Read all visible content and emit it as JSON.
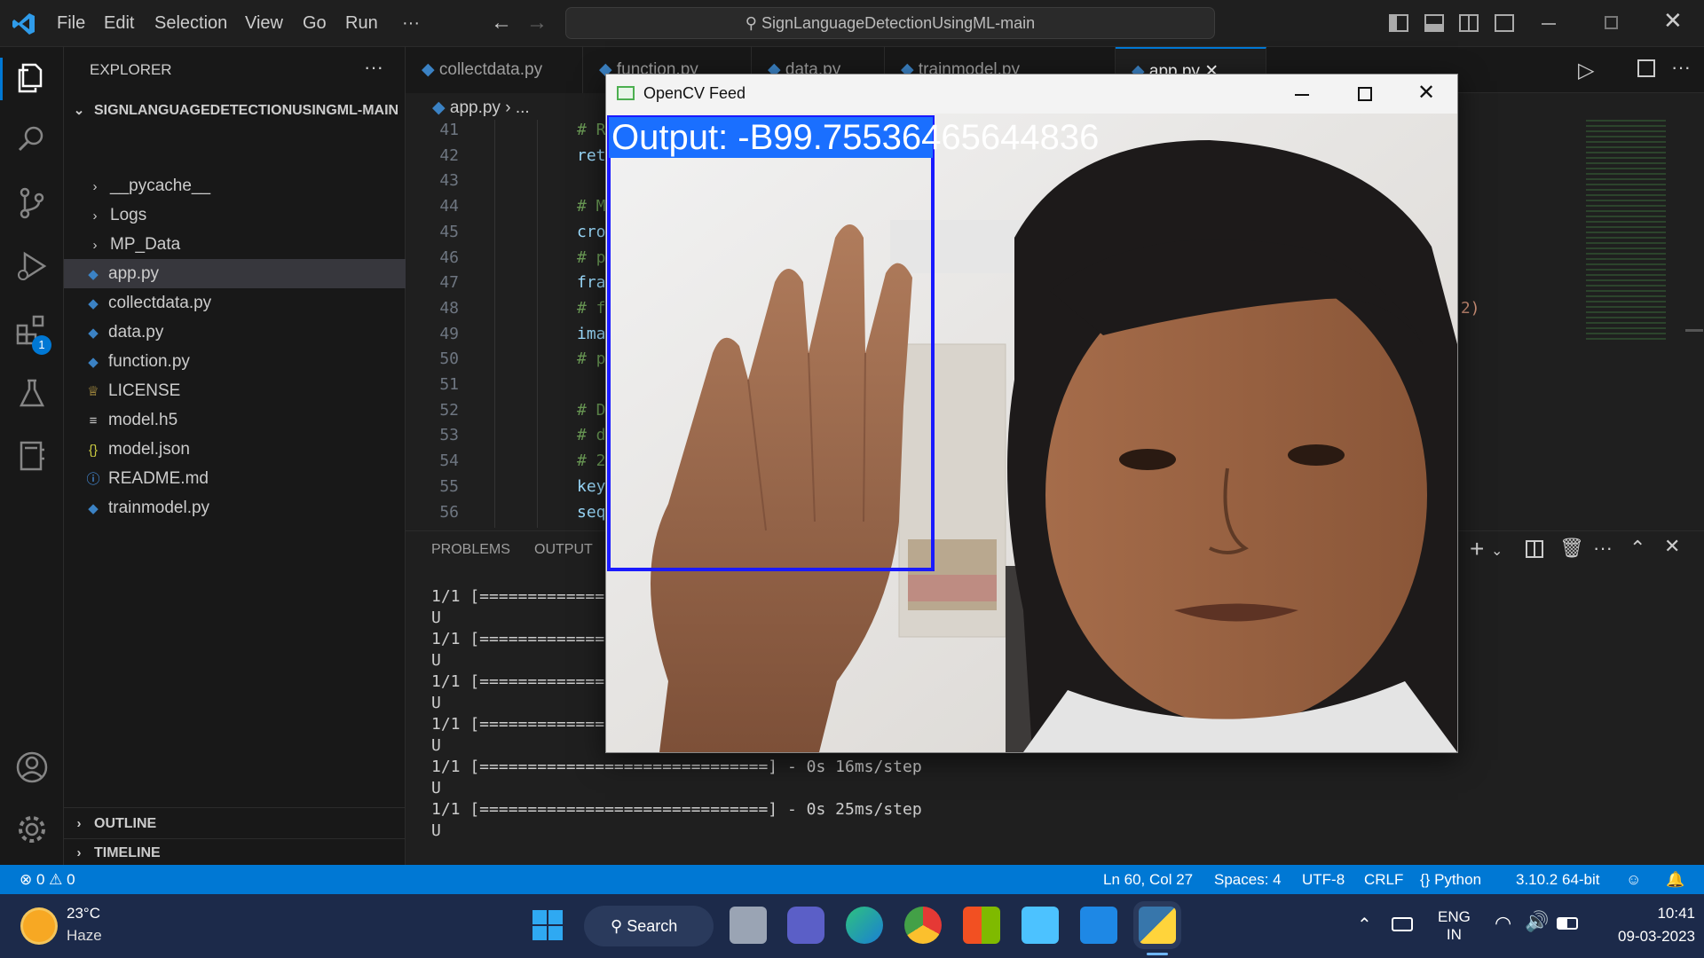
{
  "titlebar": {
    "menu": [
      "File",
      "Edit",
      "Selection",
      "View",
      "Go",
      "Run",
      "···"
    ],
    "search": "SignLanguageDetectionUsingML-main"
  },
  "activity": {
    "extensions_badge": "1"
  },
  "sidebar": {
    "title": "EXPLORER",
    "more": "···",
    "root": "SIGNLANGUAGEDETECTIONUSINGML-MAIN",
    "items": [
      {
        "label": "__pycache__",
        "icon": "chevron-right-icon",
        "glyph": "›"
      },
      {
        "label": "Logs",
        "icon": "chevron-right-icon",
        "glyph": "›"
      },
      {
        "label": "MP_Data",
        "icon": "chevron-right-icon",
        "glyph": "›"
      },
      {
        "label": "app.py",
        "icon": "python-file-icon",
        "glyph": "◆"
      },
      {
        "label": "collectdata.py",
        "icon": "python-file-icon",
        "glyph": "◆"
      },
      {
        "label": "data.py",
        "icon": "python-file-icon",
        "glyph": "◆"
      },
      {
        "label": "function.py",
        "icon": "python-file-icon",
        "glyph": "◆"
      },
      {
        "label": "LICENSE",
        "icon": "license-icon",
        "glyph": "♕"
      },
      {
        "label": "model.h5",
        "icon": "file-lines-icon",
        "glyph": "≡"
      },
      {
        "label": "model.json",
        "icon": "json-icon",
        "glyph": "{}"
      },
      {
        "label": "README.md",
        "icon": "info-icon",
        "glyph": "ⓘ"
      },
      {
        "label": "trainmodel.py",
        "icon": "python-file-icon",
        "glyph": "◆"
      }
    ],
    "outline": "OUTLINE",
    "timeline": "TIMELINE"
  },
  "editor": {
    "tabs": [
      "collectdata.py",
      "function.py",
      "data.py",
      "trainmodel.py",
      "app.py"
    ],
    "breadcrumb": {
      "file": "app.py",
      "rest": "..."
    },
    "lines": [
      {
        "n": "41",
        "code": "# R"
      },
      {
        "n": "42",
        "code": "ret"
      },
      {
        "n": "43",
        "code": ""
      },
      {
        "n": "44",
        "code": "# M"
      },
      {
        "n": "45",
        "code": "cro"
      },
      {
        "n": "46",
        "code": "# p"
      },
      {
        "n": "47",
        "code": "fra"
      },
      {
        "n": "48",
        "code": "# f"
      },
      {
        "n": "49",
        "code": "ima"
      },
      {
        "n": "50",
        "code": "# p"
      },
      {
        "n": "51",
        "code": ""
      },
      {
        "n": "52",
        "code": "# D"
      },
      {
        "n": "53",
        "code": "# d"
      },
      {
        "n": "54",
        "code": "# 2"
      },
      {
        "n": "55",
        "code": "key"
      },
      {
        "n": "56",
        "code": "seq"
      }
    ],
    "overflow_text": ",2)"
  },
  "panel": {
    "tabs": [
      "PROBLEMS",
      "OUTPUT"
    ],
    "terminal": [
      "1/1 [=============",
      "U",
      "1/1 [=============",
      "U",
      "1/1 [=============",
      "U",
      "1/1 [=============",
      "U",
      "1/1 [==============================] - 0s 16ms/step",
      "U",
      "1/1 [==============================] - 0s 25ms/step",
      "U"
    ]
  },
  "statusbar": {
    "errors": "0",
    "warnings": "0",
    "position": "Ln 60, Col 27",
    "spaces": "Spaces: 4",
    "encoding": "UTF-8",
    "eol": "CRLF",
    "language": "Python",
    "interpreter": "3.10.2 64-bit"
  },
  "taskbar": {
    "weather_temp": "23°C",
    "weather_desc": "Haze",
    "search": "Search",
    "lang_top": "ENG",
    "lang_bottom": "IN",
    "time": "10:41",
    "date": "09-03-2023"
  },
  "cvwindow": {
    "title": "OpenCV Feed",
    "output_text": "Output: -B99.75536465644836"
  },
  "colors": {
    "accent": "#0078d4",
    "roi_box": "#1a1aff",
    "python_icon": "#3b82c4"
  }
}
